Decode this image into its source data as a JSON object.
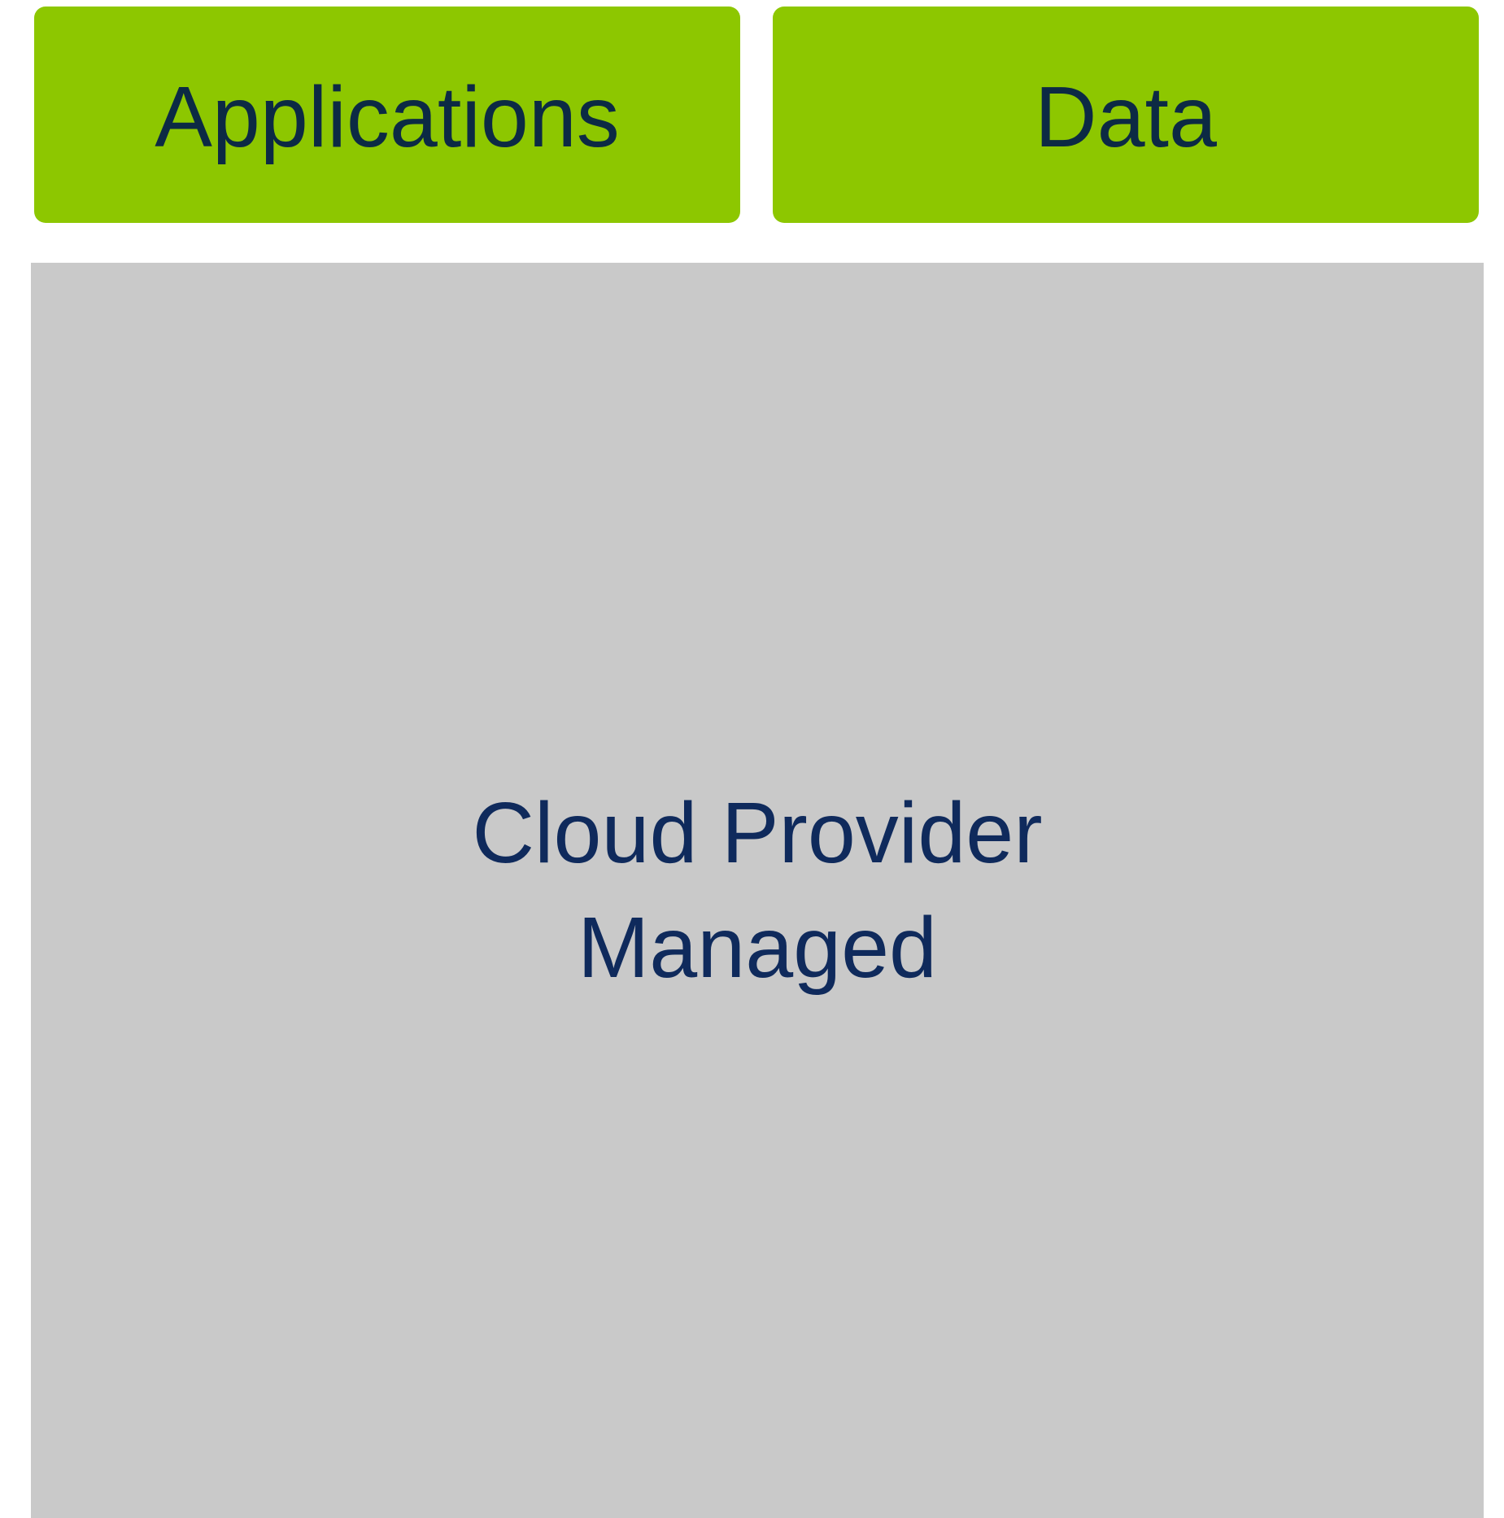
{
  "diagram": {
    "blocks": {
      "applications": {
        "label": "Applications",
        "fill": "#8dc700"
      },
      "data": {
        "label": "Data",
        "fill": "#8dc700"
      },
      "managed": {
        "line1": "Cloud Provider",
        "line2": "Managed",
        "fill": "#c9c9c9"
      }
    },
    "text_colors": {
      "green_block_text": "#0c2a44",
      "grey_block_text": "#0f2a5c"
    }
  }
}
